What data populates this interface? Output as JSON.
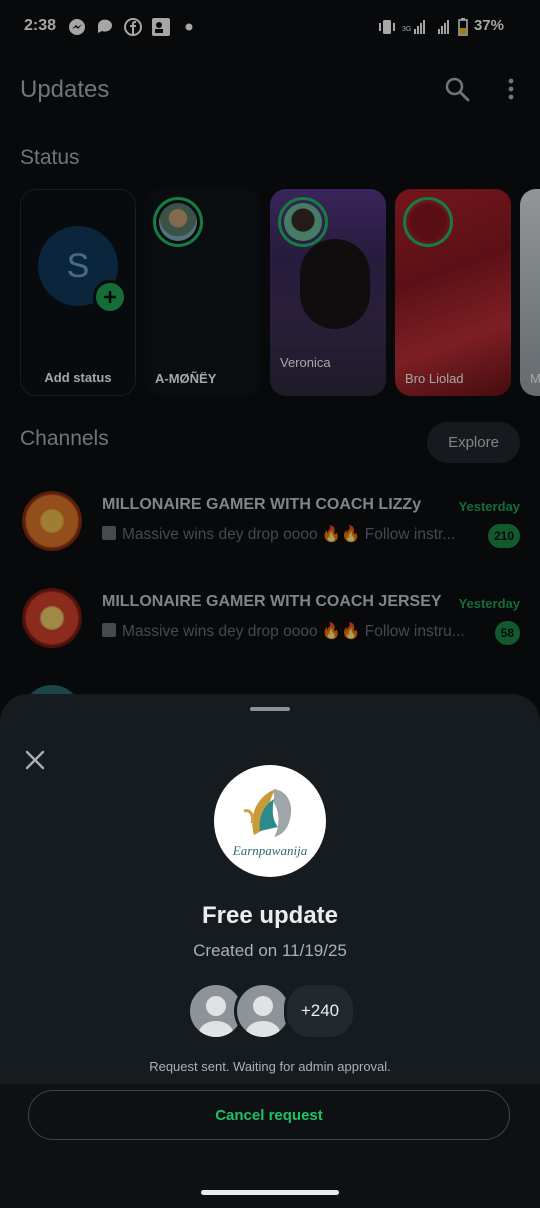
{
  "status_bar": {
    "time": "2:38",
    "battery": "37%",
    "network": "3G"
  },
  "header": {
    "title": "Updates"
  },
  "status": {
    "heading": "Status",
    "cards": [
      {
        "label": "Add status",
        "avatar_letter": "S"
      },
      {
        "label": "A-MØÑËY"
      },
      {
        "label": "Veronica"
      },
      {
        "label": "Bro Liolad"
      },
      {
        "label": "M"
      }
    ]
  },
  "channels": {
    "heading": "Channels",
    "explore_label": "Explore",
    "items": [
      {
        "name": "MILLONAIRE GAMER WITH COACH LIZZy",
        "message": "Massive wins dey drop oooo 🔥🔥  Follow instr...",
        "time": "Yesterday",
        "unread": "210"
      },
      {
        "name": "MILLONAIRE GAMER WITH COACH JERSEY",
        "message": "Massive wins dey drop oooo 🔥🔥  Follow instru...",
        "time": "Yesterday",
        "unread": "58"
      }
    ]
  },
  "sheet": {
    "logo_text": "Earnpawanija",
    "title": "Free update",
    "created": "Created on 11/19/25",
    "member_count": "+240",
    "note": "Request sent. Waiting for admin approval.",
    "cancel_label": "Cancel request"
  },
  "colors": {
    "accent": "#21c063",
    "background": "#0b0e10",
    "sheet": "#161b1f"
  }
}
